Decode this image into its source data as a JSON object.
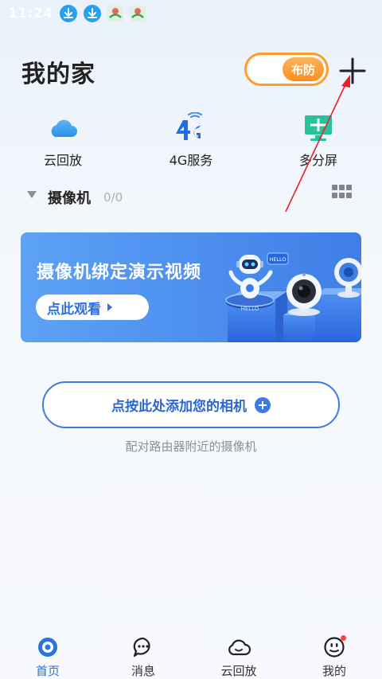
{
  "status_bar": {
    "time": "11:24"
  },
  "header": {
    "title": "我的家",
    "arm_toggle_label": "布防",
    "colors": {
      "accent_orange": "#ff9d2b"
    }
  },
  "quick_actions": [
    {
      "label": "云回放",
      "icon": "cloud-icon"
    },
    {
      "label": "4G服务",
      "icon": "4g-icon"
    },
    {
      "label": "多分屏",
      "icon": "multi-screen-icon"
    }
  ],
  "camera_section": {
    "title": "摄像机",
    "count": "0/0"
  },
  "banner": {
    "title": "摄像机绑定演示视频",
    "button_label": "点此观看",
    "art_text": "HELLO"
  },
  "add_camera": {
    "button_label": "点按此处添加您的相机",
    "hint": "配对路由器附近的摄像机"
  },
  "bottom_nav": [
    {
      "label": "首页",
      "icon": "home-icon",
      "active": true
    },
    {
      "label": "消息",
      "icon": "message-icon",
      "active": false
    },
    {
      "label": "云回放",
      "icon": "cloud-playback-icon",
      "active": false
    },
    {
      "label": "我的",
      "icon": "profile-icon",
      "active": false
    }
  ],
  "colors": {
    "primary_blue": "#2a73e0",
    "annotation_red": "#e8202a"
  }
}
